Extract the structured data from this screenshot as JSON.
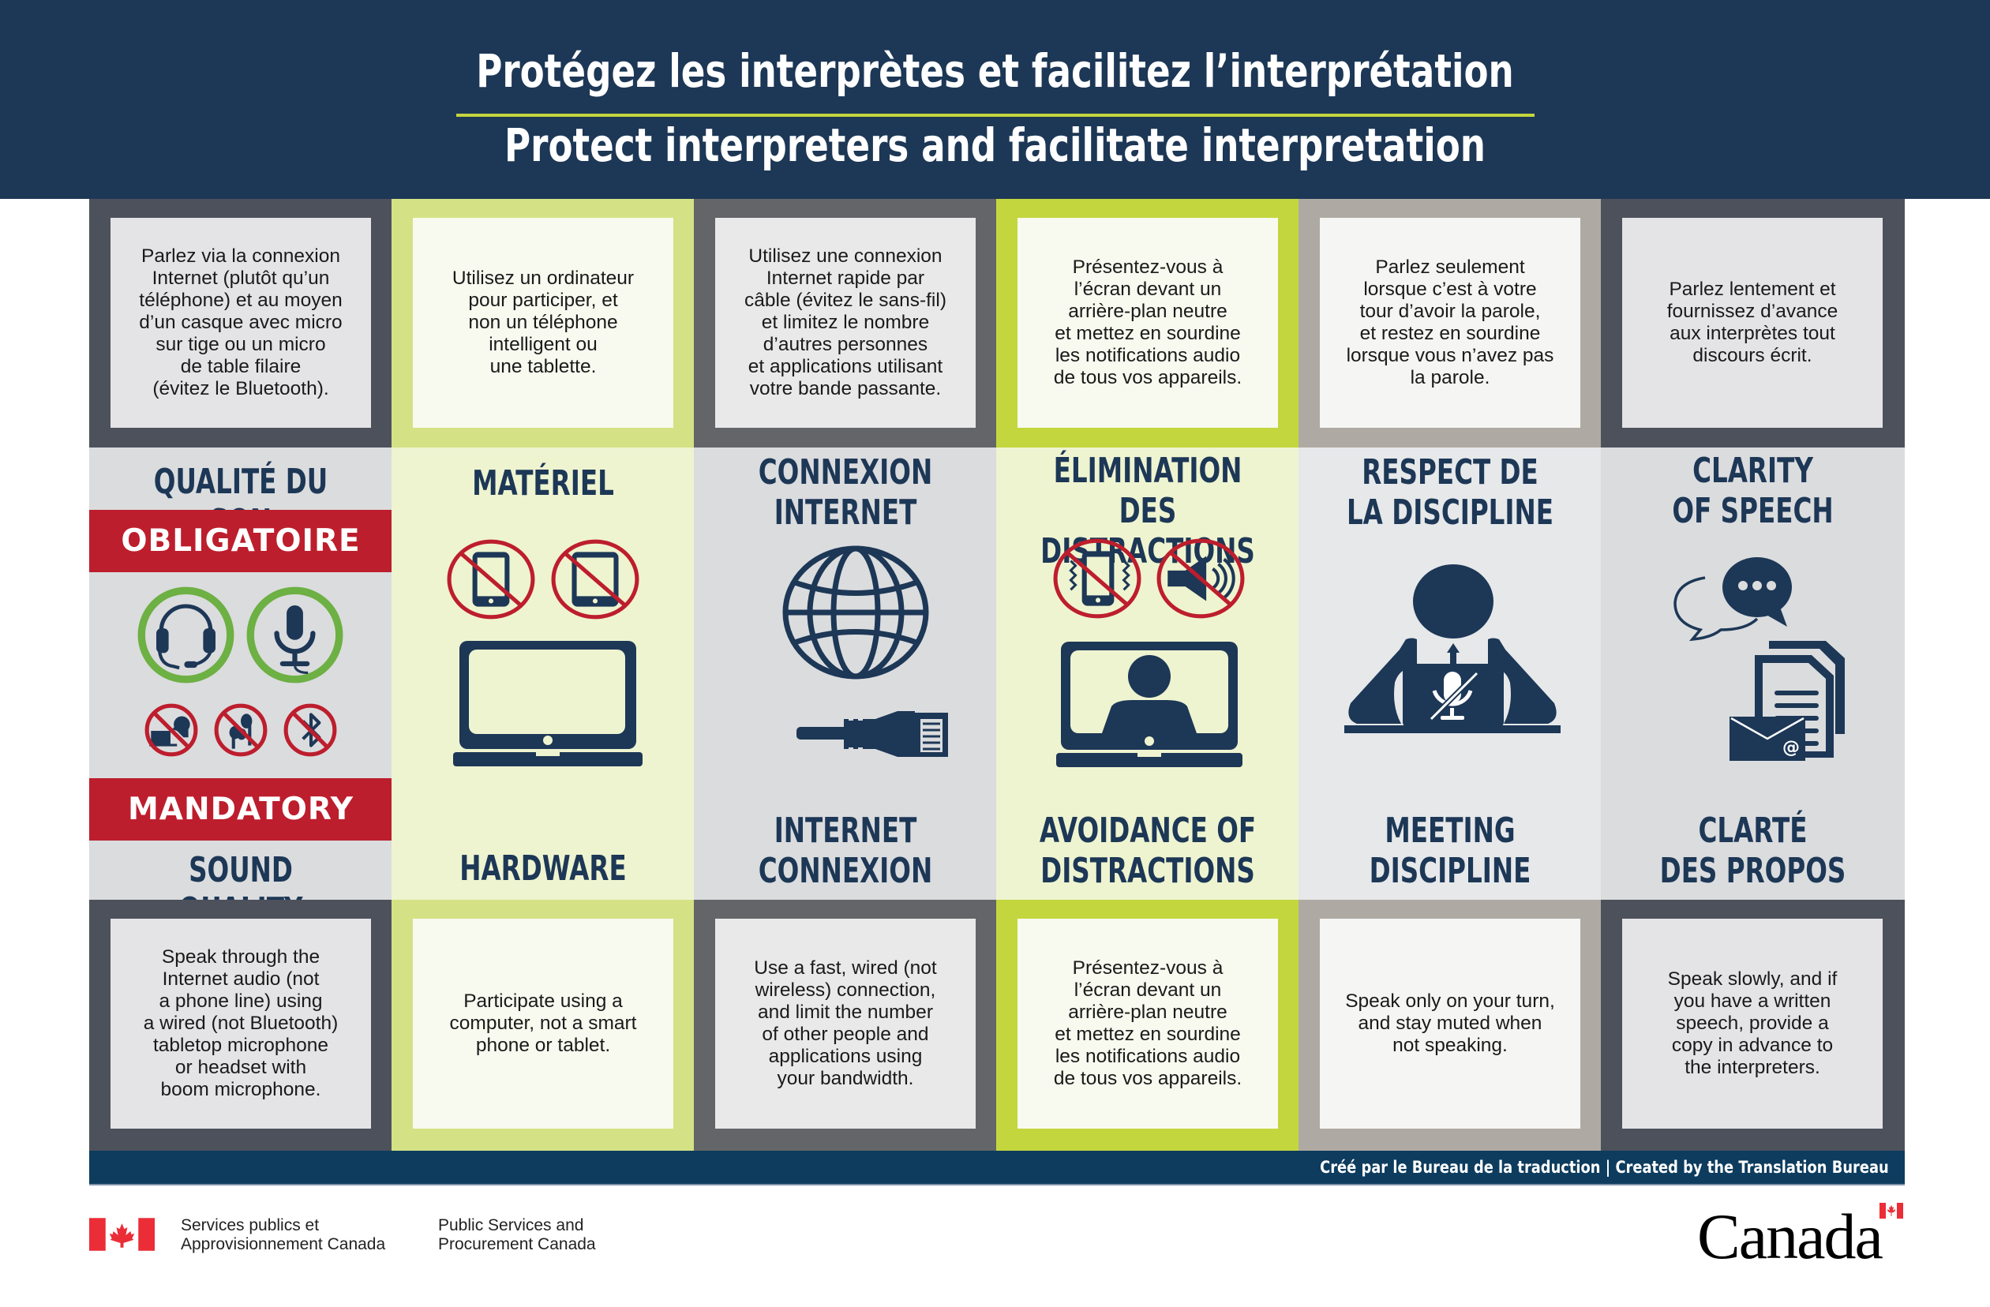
{
  "header": {
    "title_fr": "Protégez les interprètes et facilitez l’interprétation",
    "title_en": "Protect interpreters and facilitate interpretation"
  },
  "colors": {
    "header_bg": "#1d3756",
    "accent_green": "#c3d63e",
    "heading_navy": "#1d3756",
    "badge_red": "#bd1e2d",
    "ok_green": "#6db043",
    "credit_bar": "#0d3c5e"
  },
  "columns": [
    {
      "id": "sound-quality",
      "frame_color": "#4d515c",
      "card_color": "#e4e4e6",
      "mid_color": "#dbdcde",
      "top_text": "Parlez via la connexion\nInternet (plutôt qu’un\ntéléphone) et au moyen\nd’un casque avec micro\nsur tige ou un micro\nde table filaire\n(évitez le Bluetooth).",
      "heading_top": "QUALITÉ DU SON",
      "badge_top": "OBLIGATOIRE",
      "badge_bottom": "MANDATORY",
      "heading_bottom": "SOUND QUALITY",
      "icons": [
        "headset-icon",
        "microphone-icon",
        "no-speaker-laptop-icon",
        "no-earbuds-icon",
        "no-bluetooth-icon"
      ],
      "bottom_text": "Speak through the\nInternet audio (not\na phone line) using\na wired (not Bluetooth)\ntabletop microphone\nor headset with\nboom microphone."
    },
    {
      "id": "hardware",
      "frame_color": "#d4e285",
      "card_color": "#f8f9ef",
      "mid_color": "#eef4d0",
      "top_text": "Utilisez un ordinateur\npour participer, et\nnon un téléphone\nintelligent ou\nune tablette.",
      "heading_top": "MATÉRIEL",
      "heading_bottom": "HARDWARE",
      "icons": [
        "no-smartphone-icon",
        "no-tablet-icon",
        "laptop-icon"
      ],
      "bottom_text": "Participate using a\ncomputer, not a smart\nphone or tablet."
    },
    {
      "id": "internet-connexion",
      "frame_color": "#646568",
      "card_color": "#e9e9ea",
      "mid_color": "#dbdcde",
      "top_text": "Utilisez une connexion\nInternet rapide par\ncâble (évitez le sans-fil)\net limitez le nombre\nd’autres personnes\net applications utilisant\nvotre bande passante.",
      "heading_top": "CONNEXION\nINTERNET",
      "heading_bottom": "INTERNET\nCONNEXION",
      "icons": [
        "globe-icon",
        "ethernet-cable-icon"
      ],
      "bottom_text": "Use a fast, wired (not\nwireless) connection,\nand limit the number\nof other people and\napplications using\nyour bandwidth."
    },
    {
      "id": "avoid-distractions",
      "frame_color": "#c3d63e",
      "card_color": "#f8f9ef",
      "mid_color": "#eef4d0",
      "top_text": "Présentez-vous à\nl’écran devant un\narrière-plan neutre\net mettez en sourdine\nles notifications audio\nde tous vos appareils.",
      "heading_top": "ÉLIMINATION DES\nDISTRACTIONS",
      "heading_bottom": "AVOIDANCE OF\nDISTRACTIONS",
      "icons": [
        "no-vibrating-phone-icon",
        "no-sound-icon",
        "video-call-laptop-icon"
      ],
      "bottom_text": "Présentez-vous à\nl’écran devant un\narrière-plan neutre\net mettez en sourdine\nles notifications audio\nde tous vos appareils."
    },
    {
      "id": "meeting-discipline",
      "frame_color": "#aeaaa3",
      "card_color": "#f5f5f3",
      "mid_color": "#e6e8ea",
      "top_text": "Parlez seulement\nlorsque c’est à votre\ntour d’avoir la parole,\net restez en sourdine\nlorsque vous n’avez pas\nla parole.",
      "heading_top": "RESPECT DE\nLA DISCIPLINE",
      "heading_bottom": "MEETING\nDISCIPLINE",
      "icons": [
        "person-muted-laptop-icon"
      ],
      "bottom_text": "Speak only on your turn,\nand stay muted when\nnot speaking."
    },
    {
      "id": "clarity-of-speech",
      "frame_color": "#4d515c",
      "card_color": "#e4e4e6",
      "mid_color": "#dbdcde",
      "top_text": "Parlez lentement et\nfournissez d’avance\naux interprètes tout\ndiscours écrit.",
      "heading_top": "CLARITY\nOF SPEECH",
      "heading_bottom": "CLARTÉ\nDES PROPOS",
      "icons": [
        "speech-bubbles-icon",
        "documents-email-icon"
      ],
      "bottom_text": "Speak slowly, and if\nyou have a written\nspeech, provide a\ncopy in advance to\nthe interpreters."
    }
  ],
  "footer": {
    "credit": "Créé par le Bureau de la traduction | Created by the Translation Bureau",
    "dept_fr": "Services publics et\nApprovisionnement Canada",
    "dept_en": "Public Services and\nProcurement Canada",
    "wordmark": "Canada"
  }
}
